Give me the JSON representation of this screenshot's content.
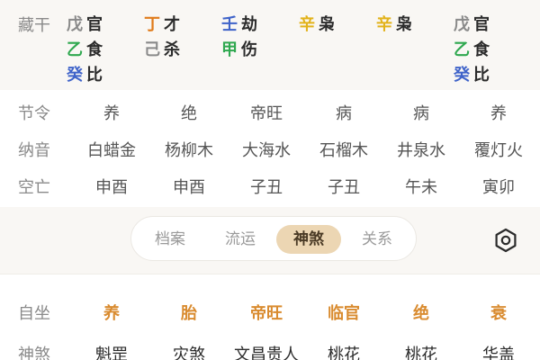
{
  "colors": {
    "wu_earth": "#8a8a8a",
    "ji_earth": "#8a8a8a",
    "wood": "#2fa84f",
    "water": "#3f63c9",
    "fire": "#e07b1a",
    "metal": "#e2b21a",
    "accent": "#ecd6b3",
    "orange": "#d98b2f"
  },
  "canggan": {
    "label": "藏干",
    "columns": [
      [
        {
          "stem": "戊",
          "god": "官",
          "color": "#8a8a8a"
        },
        {
          "stem": "乙",
          "god": "食",
          "color": "#2fa84f"
        },
        {
          "stem": "癸",
          "god": "比",
          "color": "#3f63c9"
        }
      ],
      [
        {
          "stem": "丁",
          "god": "才",
          "color": "#e07b1a"
        },
        {
          "stem": "己",
          "god": "杀",
          "color": "#8a8a8a"
        }
      ],
      [
        {
          "stem": "壬",
          "god": "劫",
          "color": "#3f63c9"
        },
        {
          "stem": "甲",
          "god": "伤",
          "color": "#2fa84f"
        }
      ],
      [
        {
          "stem": "辛",
          "god": "枭",
          "color": "#e2b21a"
        }
      ],
      [
        {
          "stem": "辛",
          "god": "枭",
          "color": "#e2b21a"
        }
      ],
      [
        {
          "stem": "戊",
          "god": "官",
          "color": "#8a8a8a"
        },
        {
          "stem": "乙",
          "god": "食",
          "color": "#2fa84f"
        },
        {
          "stem": "癸",
          "god": "比",
          "color": "#3f63c9"
        }
      ]
    ]
  },
  "rows": [
    {
      "label": "节令",
      "values": [
        "养",
        "绝",
        "帝旺",
        "病",
        "病",
        "养"
      ]
    },
    {
      "label": "纳音",
      "values": [
        "白蜡金",
        "杨柳木",
        "大海水",
        "石榴木",
        "井泉水",
        "覆灯火"
      ]
    },
    {
      "label": "空亡",
      "values": [
        "申酉",
        "申酉",
        "子丑",
        "子丑",
        "午未",
        "寅卯"
      ]
    }
  ],
  "tabs": [
    "档案",
    "流运",
    "神煞",
    "关系"
  ],
  "active_tab": "神煞",
  "settings_icon": "settings-hexagon-icon",
  "bottom_rows": [
    {
      "label": "自坐",
      "values": [
        "养",
        "胎",
        "帝旺",
        "临官",
        "绝",
        "衰"
      ],
      "style": "orange"
    },
    {
      "label": "神煞",
      "values": [
        "魁罡",
        "灾煞",
        "文昌贵人",
        "桃花",
        "桃花",
        "华盖"
      ],
      "style": "dark"
    }
  ]
}
